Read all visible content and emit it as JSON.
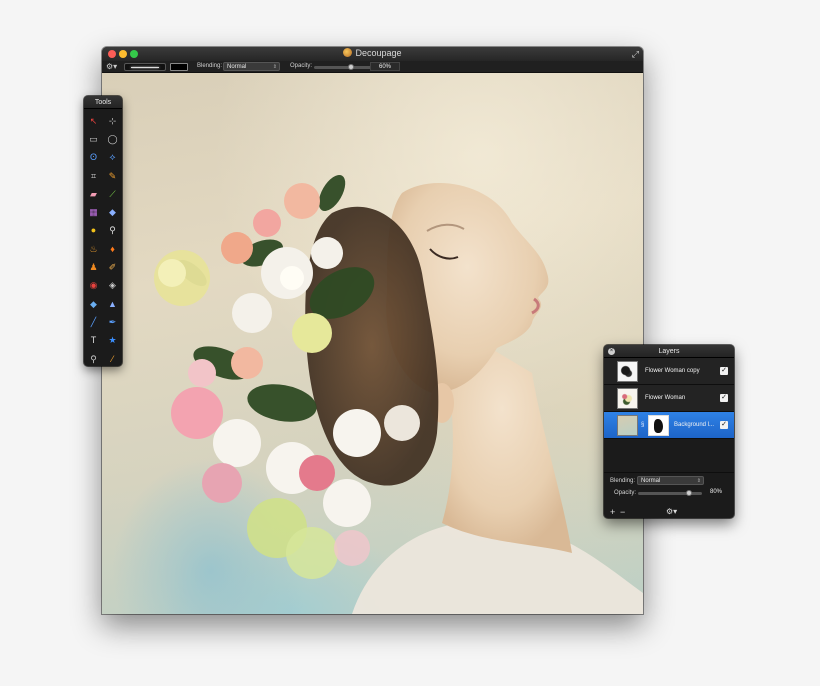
{
  "window": {
    "title": "Decoupage"
  },
  "toolbar": {
    "blending_label": "Blending:",
    "blending_value": "Normal",
    "opacity_label": "Opacity:",
    "opacity_value": "60%",
    "opacity_fraction": 0.6
  },
  "tools_palette": {
    "title": "Tools",
    "tools": [
      {
        "name": "move-tool-icon",
        "glyph": "↖",
        "color": "#e8423e"
      },
      {
        "name": "zoom-select-icon",
        "glyph": "⊹",
        "color": "#bbbbbb"
      },
      {
        "name": "rect-select-icon",
        "glyph": "▭",
        "color": "#cccccc"
      },
      {
        "name": "ellipse-select-icon",
        "glyph": "◯",
        "color": "#cccccc"
      },
      {
        "name": "lasso-icon",
        "glyph": "ʘ",
        "color": "#5aa0ff"
      },
      {
        "name": "polygon-lasso-icon",
        "glyph": "⟡",
        "color": "#5aa0ff"
      },
      {
        "name": "crop-icon",
        "glyph": "⌗",
        "color": "#cccccc"
      },
      {
        "name": "eyedropper-icon",
        "glyph": "✎",
        "color": "#f0a030"
      },
      {
        "name": "eraser-icon",
        "glyph": "▰",
        "color": "#f29db4"
      },
      {
        "name": "brush-icon",
        "glyph": "⟋",
        "color": "#7bd14a"
      },
      {
        "name": "gradient-icon",
        "glyph": "▦",
        "color": "#c070e0"
      },
      {
        "name": "paint-bucket-icon",
        "glyph": "◆",
        "color": "#8ab0ff"
      },
      {
        "name": "blob-icon",
        "glyph": "●",
        "color": "#f2c11a"
      },
      {
        "name": "pin-icon",
        "glyph": "⚲",
        "color": "#e0e0e0"
      },
      {
        "name": "smudge-icon",
        "glyph": "♨",
        "color": "#f0a030"
      },
      {
        "name": "flame-icon",
        "glyph": "♦",
        "color": "#ff7a1a"
      },
      {
        "name": "stamp-icon",
        "glyph": "♟",
        "color": "#f08a20"
      },
      {
        "name": "pencil-icon",
        "glyph": "✐",
        "color": "#f0b050"
      },
      {
        "name": "red-eye-icon",
        "glyph": "◉",
        "color": "#e8423e"
      },
      {
        "name": "sponge-icon",
        "glyph": "◈",
        "color": "#cccccc"
      },
      {
        "name": "drop-icon",
        "glyph": "◆",
        "color": "#6aaef0"
      },
      {
        "name": "sharpen-icon",
        "glyph": "▲",
        "color": "#8ab0ff"
      },
      {
        "name": "line-icon",
        "glyph": "╱",
        "color": "#5aa0ff"
      },
      {
        "name": "pen-icon",
        "glyph": "✒",
        "color": "#5aa0ff"
      },
      {
        "name": "text-icon",
        "glyph": "T",
        "color": "#dddddd"
      },
      {
        "name": "shape-star-icon",
        "glyph": "★",
        "color": "#3b8fff"
      },
      {
        "name": "magnifier-icon",
        "glyph": "⚲",
        "color": "#cccccc"
      },
      {
        "name": "color-picker-icon",
        "glyph": "⁄",
        "color": "#f0a030"
      }
    ]
  },
  "layers_panel": {
    "title": "Layers",
    "layers": [
      {
        "name": "Flower Woman copy",
        "visible": true,
        "selected": false
      },
      {
        "name": "Flower Woman",
        "visible": true,
        "selected": false
      },
      {
        "name": "Background l...",
        "visible": true,
        "selected": true
      }
    ],
    "blending_label": "Blending:",
    "blending_value": "Normal",
    "opacity_label": "Opacity:",
    "opacity_value": "80%",
    "opacity_fraction": 0.8,
    "add_label": "+",
    "remove_label": "−"
  },
  "colors": {
    "selection_blue": "#2a7be0",
    "panel_dark": "#1b1b1b"
  }
}
